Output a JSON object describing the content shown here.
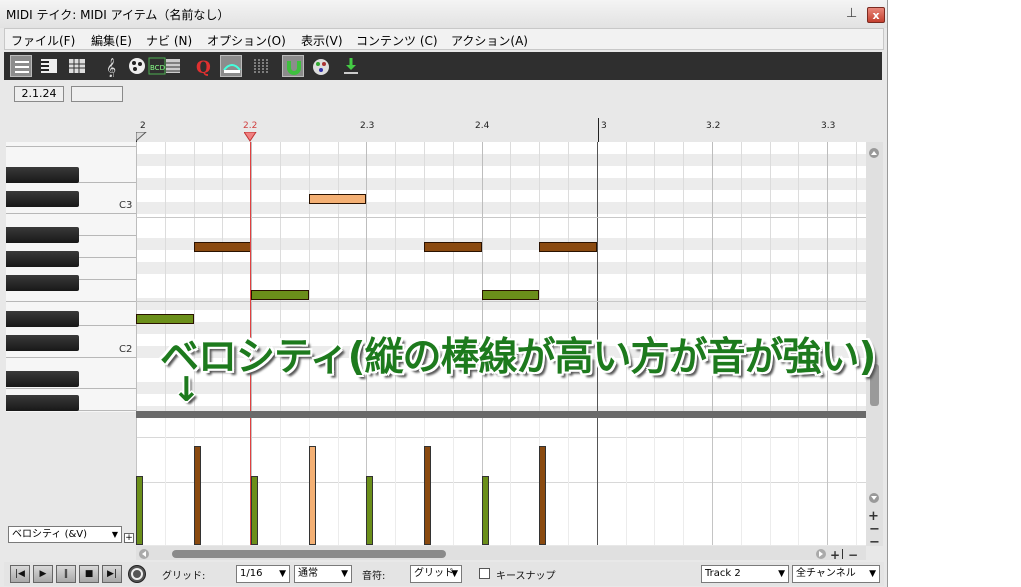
{
  "window": {
    "title": "MIDI テイク: MIDI アイテム（名前なし）",
    "pin_icon": "pin-icon",
    "close_label": "x"
  },
  "menu": [
    "ファイル(F)",
    "編集(E)",
    "ナビ (N)",
    "オプション(O)",
    "表示(V)",
    "コンテンツ (C)",
    "アクション(A)"
  ],
  "toolbar": {
    "icons": [
      "list-view-icon",
      "piano-roll-icon",
      "grid-view-icon",
      "treble-clef-icon",
      "palette-icon",
      "step-input-icon",
      "event-list-icon",
      "quantize-icon",
      "note-preview-icon",
      "grid-snap-icon",
      "magnet-icon",
      "color-palette-icon",
      "insert-note-icon"
    ],
    "quantize_glyph": "Q"
  },
  "position": {
    "value": "2.1.24",
    "secondary": ""
  },
  "ruler": {
    "marks": [
      "2",
      "2.2",
      "2.3",
      "2.4",
      "3",
      "3.2",
      "3.3"
    ]
  },
  "piano": {
    "c3_label": "C3",
    "c2_label": "C2"
  },
  "notes": [
    {
      "start": 0,
      "length": 1,
      "pitch_row": 17,
      "color": "#6b8f1a"
    },
    {
      "start": 1,
      "length": 1,
      "pitch_row": 11,
      "color": "#8a4a10"
    },
    {
      "start": 2,
      "length": 1,
      "pitch_row": 15,
      "color": "#6b8f1a"
    },
    {
      "start": 3,
      "length": 1,
      "pitch_row": 7,
      "color": "#f4b074"
    },
    {
      "start": 5,
      "length": 1,
      "pitch_row": 11,
      "color": "#8a4a10"
    },
    {
      "start": 6,
      "length": 1,
      "pitch_row": 15,
      "color": "#6b8f1a"
    },
    {
      "start": 7,
      "length": 1,
      "pitch_row": 11,
      "color": "#8a4a10"
    }
  ],
  "velocities": [
    {
      "start": 0,
      "velocity": 0.54,
      "color": "#6b8f1a"
    },
    {
      "start": 1,
      "velocity": 0.78,
      "color": "#8a4a10"
    },
    {
      "start": 2,
      "velocity": 0.54,
      "color": "#6b8f1a"
    },
    {
      "start": 3,
      "velocity": 0.78,
      "color": "#f4b074"
    },
    {
      "start": 4,
      "velocity": 0.54,
      "color": "#6b8f1a"
    },
    {
      "start": 5,
      "velocity": 0.78,
      "color": "#8a4a10"
    },
    {
      "start": 6,
      "velocity": 0.54,
      "color": "#6b8f1a"
    },
    {
      "start": 7,
      "velocity": 0.78,
      "color": "#8a4a10"
    }
  ],
  "lane": {
    "selector": "ベロシティ (&V)"
  },
  "transport": [
    "rewind-icon",
    "play-icon",
    "pause-icon",
    "stop-icon",
    "end-icon",
    "loop-icon"
  ],
  "bottom": {
    "grid_label": "グリッド:",
    "grid_value": "1/16",
    "grid_type": "通常",
    "note_label": "音符:",
    "note_value": "グリッド",
    "keysnap_label": "キースナップ",
    "track_value": "Track 2",
    "channel_value": "全チャンネル"
  },
  "overlay": {
    "caption": "ベロシティ(縦の棒線が高い方が音が強い)",
    "arrow": "↓"
  }
}
